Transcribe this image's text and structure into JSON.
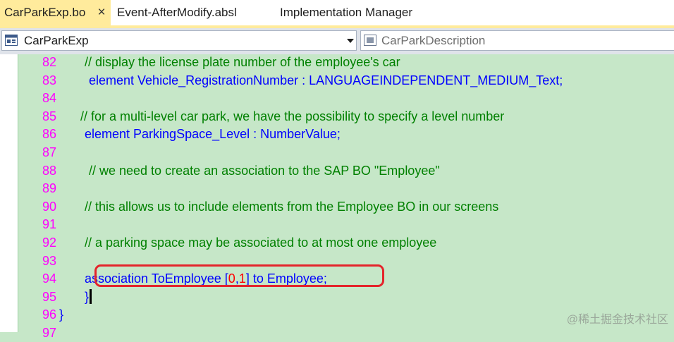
{
  "tabs": [
    {
      "label": "CarParkExp.bo",
      "active": true,
      "closable": true
    },
    {
      "label": "Event-AfterModify.absl",
      "active": false
    },
    {
      "label": "Implementation Manager",
      "active": false
    }
  ],
  "tab_close_glyph": "×",
  "navbar": {
    "type_combo": {
      "value": "CarParkExp",
      "icon": "class-icon"
    },
    "member_combo": {
      "value": "CarParkDescription",
      "icon": "member-icon"
    }
  },
  "editor": {
    "lines": [
      {
        "no": "82",
        "indent": 120,
        "tokens": [
          {
            "c": "cm",
            "t": "// display the license plate number of the employee's car"
          }
        ]
      },
      {
        "no": "83",
        "indent": 126,
        "tokens": [
          {
            "c": "kw",
            "t": "element Vehicle_RegistrationNumber : LANGUAGEINDEPENDENT_MEDIUM_Text;"
          }
        ]
      },
      {
        "no": "84",
        "indent": 0,
        "tokens": []
      },
      {
        "no": "85",
        "indent": 114,
        "tokens": [
          {
            "c": "cm",
            "t": "// for a multi-level car park, we have the possibility to specify a level number"
          }
        ]
      },
      {
        "no": "86",
        "indent": 120,
        "tokens": [
          {
            "c": "kw",
            "t": "element ParkingSpace_Level : NumberValue;"
          }
        ]
      },
      {
        "no": "87",
        "indent": 0,
        "tokens": []
      },
      {
        "no": "88",
        "indent": 126,
        "tokens": [
          {
            "c": "cm",
            "t": "// we need to create an association to the SAP BO \"Employee\""
          }
        ]
      },
      {
        "no": "89",
        "indent": 0,
        "tokens": []
      },
      {
        "no": "90",
        "indent": 120,
        "tokens": [
          {
            "c": "cm",
            "t": "// this allows us to include elements from the Employee BO in our screens"
          }
        ]
      },
      {
        "no": "91",
        "indent": 0,
        "tokens": []
      },
      {
        "no": "92",
        "indent": 120,
        "tokens": [
          {
            "c": "cm",
            "t": "// a parking space may be associated to at most one employee"
          }
        ]
      },
      {
        "no": "93",
        "indent": 0,
        "tokens": []
      },
      {
        "no": "94",
        "indent": 120,
        "tokens": [
          {
            "c": "kw",
            "t": "association ToEmployee ["
          },
          {
            "c": "num",
            "t": "0"
          },
          {
            "c": "kw",
            "t": ","
          },
          {
            "c": "num",
            "t": "1"
          },
          {
            "c": "kw",
            "t": "] to Employee;"
          }
        ]
      },
      {
        "no": "95",
        "indent": 120,
        "tokens": [
          {
            "c": "kw",
            "t": "}"
          }
        ],
        "caret": true
      },
      {
        "no": "96",
        "indent": 84,
        "tokens": [
          {
            "c": "kw",
            "t": "}"
          }
        ]
      },
      {
        "no": "97",
        "indent": 0,
        "tokens": []
      }
    ]
  },
  "watermark": "@稀土掘金技术社区",
  "colors": {
    "editor_bg": "#c6e7c8",
    "line_number": "#ff00ff",
    "comment": "#008000",
    "keyword": "#0000ff",
    "number": "#ff0000",
    "active_tab": "#ffeb9c",
    "highlight_box": "#e4242b"
  }
}
